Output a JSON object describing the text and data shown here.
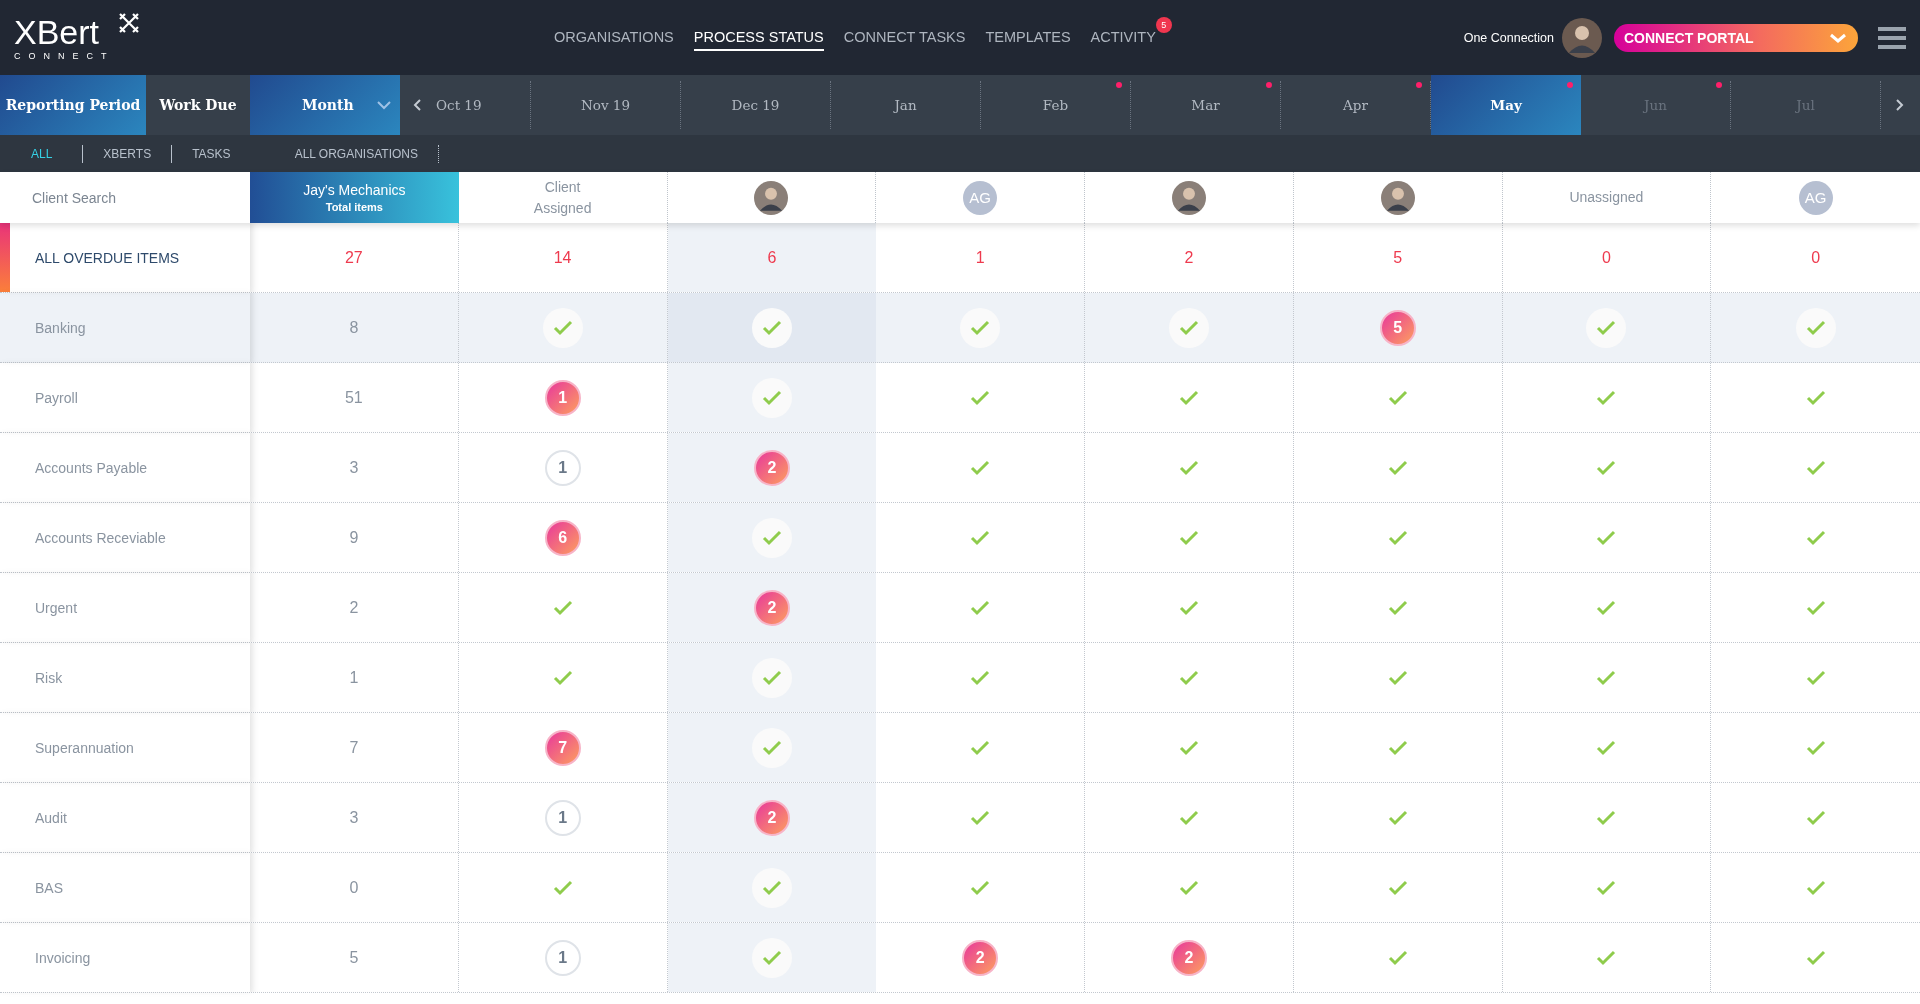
{
  "logo": {
    "name": "XBert",
    "tagline": "CONNECT"
  },
  "nav": [
    {
      "label": "ORGANISATIONS",
      "selected": false
    },
    {
      "label": "PROCESS STATUS",
      "selected": true
    },
    {
      "label": "CONNECT TASKS",
      "selected": false
    },
    {
      "label": "TEMPLATES",
      "selected": false
    },
    {
      "label": "ACTIVITY",
      "selected": false,
      "badge": "5"
    }
  ],
  "user": {
    "name": "One Connection"
  },
  "portal_button": {
    "label": "CONNECT PORTAL"
  },
  "period_toggle": [
    {
      "label": "Reporting Period",
      "selected": true
    },
    {
      "label": "Work Due",
      "selected": false
    }
  ],
  "period_dropdown": {
    "value": "Month"
  },
  "months": [
    {
      "label": "Oct 19",
      "selected": false,
      "flagged": false,
      "disabled": false
    },
    {
      "label": "Nov 19",
      "selected": false,
      "flagged": false,
      "disabled": false
    },
    {
      "label": "Dec 19",
      "selected": false,
      "flagged": false,
      "disabled": false
    },
    {
      "label": "Jan",
      "selected": false,
      "flagged": false,
      "disabled": false
    },
    {
      "label": "Feb",
      "selected": false,
      "flagged": true,
      "disabled": false
    },
    {
      "label": "Mar",
      "selected": false,
      "flagged": true,
      "disabled": false
    },
    {
      "label": "Apr",
      "selected": false,
      "flagged": true,
      "disabled": false
    },
    {
      "label": "May",
      "selected": true,
      "flagged": true,
      "disabled": false
    },
    {
      "label": "Jun",
      "selected": false,
      "flagged": true,
      "disabled": true
    },
    {
      "label": "Jul",
      "selected": false,
      "flagged": false,
      "disabled": true
    }
  ],
  "filters": [
    {
      "label": "ALL",
      "selected": true
    },
    {
      "label": "XBERTS",
      "selected": false
    },
    {
      "label": "TASKS",
      "selected": false
    },
    {
      "label": "ALL ORGANISATIONS",
      "selected": false
    }
  ],
  "search": {
    "placeholder": "Client Search"
  },
  "columns": [
    {
      "kind": "total",
      "title": "Jay's Mechanics",
      "subtitle": "Total items",
      "selected": false
    },
    {
      "kind": "text",
      "label": "Client Assigned",
      "selected": false
    },
    {
      "kind": "avatar",
      "selected": true
    },
    {
      "kind": "initials",
      "label": "AG",
      "selected": false
    },
    {
      "kind": "avatar",
      "selected": false
    },
    {
      "kind": "avatar",
      "selected": false
    },
    {
      "kind": "text",
      "label": "Unassigned",
      "selected": false
    },
    {
      "kind": "initials",
      "label": "AG",
      "selected": false
    }
  ],
  "rows": [
    {
      "kind": "summary",
      "label": "ALL OVERDUE ITEMS",
      "selected": false,
      "cells": [
        {
          "kind": "number",
          "value": "27"
        },
        {
          "kind": "number",
          "value": "14"
        },
        {
          "kind": "number",
          "value": "6"
        },
        {
          "kind": "number",
          "value": "1"
        },
        {
          "kind": "number",
          "value": "2"
        },
        {
          "kind": "number",
          "value": "5"
        },
        {
          "kind": "number",
          "value": "0"
        },
        {
          "kind": "number",
          "value": "0"
        }
      ]
    },
    {
      "kind": "process",
      "label": "Banking",
      "selected": true,
      "cells": [
        {
          "kind": "number",
          "value": "8"
        },
        {
          "kind": "check"
        },
        {
          "kind": "check"
        },
        {
          "kind": "check"
        },
        {
          "kind": "check"
        },
        {
          "kind": "overdue",
          "value": "5"
        },
        {
          "kind": "check"
        },
        {
          "kind": "check"
        }
      ]
    },
    {
      "kind": "process",
      "label": "Payroll",
      "selected": false,
      "cells": [
        {
          "kind": "number",
          "value": "51"
        },
        {
          "kind": "overdue",
          "value": "1"
        },
        {
          "kind": "check"
        },
        {
          "kind": "check"
        },
        {
          "kind": "check"
        },
        {
          "kind": "check"
        },
        {
          "kind": "check"
        },
        {
          "kind": "check"
        }
      ]
    },
    {
      "kind": "process",
      "label": "Accounts Payable",
      "selected": false,
      "cells": [
        {
          "kind": "number",
          "value": "3"
        },
        {
          "kind": "pending",
          "value": "1"
        },
        {
          "kind": "overdue",
          "value": "2"
        },
        {
          "kind": "check"
        },
        {
          "kind": "check"
        },
        {
          "kind": "check"
        },
        {
          "kind": "check"
        },
        {
          "kind": "check"
        }
      ]
    },
    {
      "kind": "process",
      "label": "Accounts Receviable",
      "selected": false,
      "cells": [
        {
          "kind": "number",
          "value": "9"
        },
        {
          "kind": "overdue",
          "value": "6"
        },
        {
          "kind": "check"
        },
        {
          "kind": "check"
        },
        {
          "kind": "check"
        },
        {
          "kind": "check"
        },
        {
          "kind": "check"
        },
        {
          "kind": "check"
        }
      ]
    },
    {
      "kind": "process",
      "label": "Urgent",
      "selected": false,
      "cells": [
        {
          "kind": "number",
          "value": "2"
        },
        {
          "kind": "check"
        },
        {
          "kind": "overdue",
          "value": "2"
        },
        {
          "kind": "check"
        },
        {
          "kind": "check"
        },
        {
          "kind": "check"
        },
        {
          "kind": "check"
        },
        {
          "kind": "check"
        }
      ]
    },
    {
      "kind": "process",
      "label": "Risk",
      "selected": false,
      "cells": [
        {
          "kind": "number",
          "value": "1"
        },
        {
          "kind": "check"
        },
        {
          "kind": "check"
        },
        {
          "kind": "check"
        },
        {
          "kind": "check"
        },
        {
          "kind": "check"
        },
        {
          "kind": "check"
        },
        {
          "kind": "check"
        }
      ]
    },
    {
      "kind": "process",
      "label": "Superannuation",
      "selected": false,
      "cells": [
        {
          "kind": "number",
          "value": "7"
        },
        {
          "kind": "overdue",
          "value": "7"
        },
        {
          "kind": "check"
        },
        {
          "kind": "check"
        },
        {
          "kind": "check"
        },
        {
          "kind": "check"
        },
        {
          "kind": "check"
        },
        {
          "kind": "check"
        }
      ]
    },
    {
      "kind": "process",
      "label": "Audit",
      "selected": false,
      "cells": [
        {
          "kind": "number",
          "value": "3"
        },
        {
          "kind": "pending",
          "value": "1"
        },
        {
          "kind": "overdue",
          "value": "2"
        },
        {
          "kind": "check"
        },
        {
          "kind": "check"
        },
        {
          "kind": "check"
        },
        {
          "kind": "check"
        },
        {
          "kind": "check"
        }
      ]
    },
    {
      "kind": "process",
      "label": "BAS",
      "selected": false,
      "cells": [
        {
          "kind": "number",
          "value": "0"
        },
        {
          "kind": "check"
        },
        {
          "kind": "check"
        },
        {
          "kind": "check"
        },
        {
          "kind": "check"
        },
        {
          "kind": "check"
        },
        {
          "kind": "check"
        },
        {
          "kind": "check"
        }
      ]
    },
    {
      "kind": "process",
      "label": "Invoicing",
      "selected": false,
      "cells": [
        {
          "kind": "number",
          "value": "5"
        },
        {
          "kind": "pending",
          "value": "1"
        },
        {
          "kind": "check"
        },
        {
          "kind": "overdue",
          "value": "2"
        },
        {
          "kind": "overdue",
          "value": "2"
        },
        {
          "kind": "check"
        },
        {
          "kind": "check"
        },
        {
          "kind": "check"
        }
      ]
    }
  ]
}
